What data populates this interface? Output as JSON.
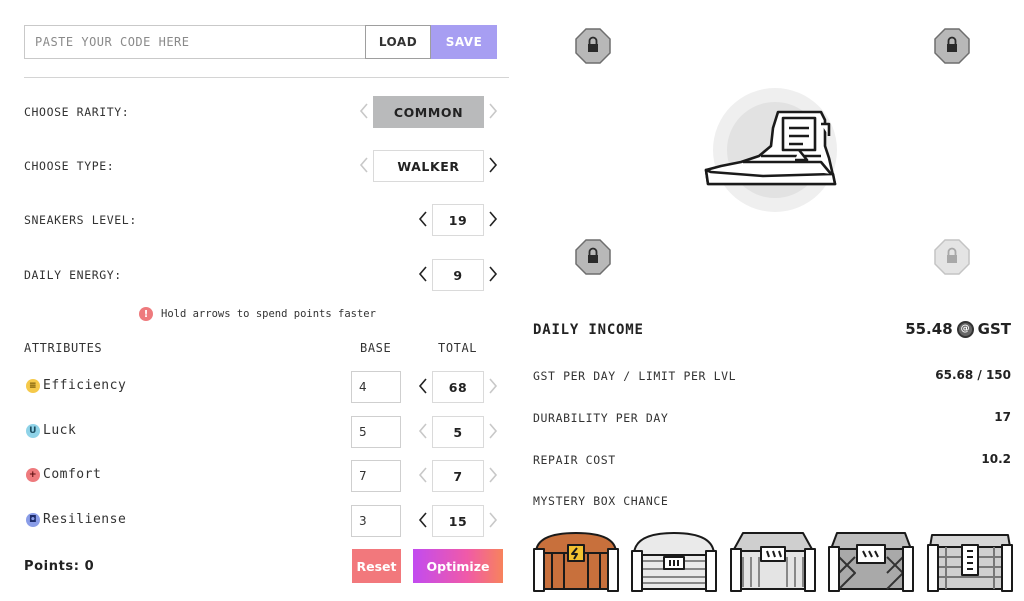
{
  "code": {
    "placeholder": "PASTE YOUR CODE HERE",
    "load_label": "LOAD",
    "save_label": "SAVE"
  },
  "settings": {
    "rarity": {
      "label": "CHOOSE RARITY:",
      "value": "COMMON"
    },
    "type": {
      "label": "CHOOSE TYPE:",
      "value": "WALKER"
    },
    "level": {
      "label": "SNEAKERS LEVEL:",
      "value": "19"
    },
    "energy": {
      "label": "DAILY ENERGY:",
      "value": "9"
    }
  },
  "hint": {
    "icon": "!",
    "text": "Hold arrows to spend points faster"
  },
  "attributes": {
    "header": "ATTRIBUTES",
    "base_header": "BASE",
    "total_header": "TOTAL",
    "rows": [
      {
        "name": "Efficiency",
        "icon": "efficiency-icon",
        "glyph": "≡",
        "color": "#f5c94a",
        "base": "4",
        "total": "68"
      },
      {
        "name": "Luck",
        "icon": "luck-icon",
        "glyph": "U",
        "color": "#8fd3e8",
        "base": "5",
        "total": "5"
      },
      {
        "name": "Comfort",
        "icon": "comfort-icon",
        "glyph": "+",
        "color": "#ee7a7d",
        "base": "7",
        "total": "7"
      },
      {
        "name": "Resiliense",
        "icon": "resilience-icon",
        "glyph": "◘",
        "color": "#8a9de8",
        "base": "3",
        "total": "15"
      }
    ]
  },
  "footer": {
    "points": "Points: 0",
    "reset_label": "Reset",
    "optimize_label": "Optimize"
  },
  "income": {
    "title": "DAILY INCOME",
    "value": "55.48",
    "currency": "GST"
  },
  "stats": {
    "gst_per_day": {
      "label": "GST PER DAY / LIMIT PER LVL",
      "value": "65.68 / 150"
    },
    "durability": {
      "label": "DURABILITY PER DAY",
      "value": "17"
    },
    "repair": {
      "label": "REPAIR COST",
      "value": "10.2"
    },
    "mystery": {
      "label": "MYSTERY BOX CHANCE"
    }
  },
  "colors": {
    "accent": "#a79ef2",
    "reset": "#f2787c",
    "optimize_start": "#c24bf0",
    "optimize_end": "#f7835c",
    "box_orange": "#c8703c"
  }
}
